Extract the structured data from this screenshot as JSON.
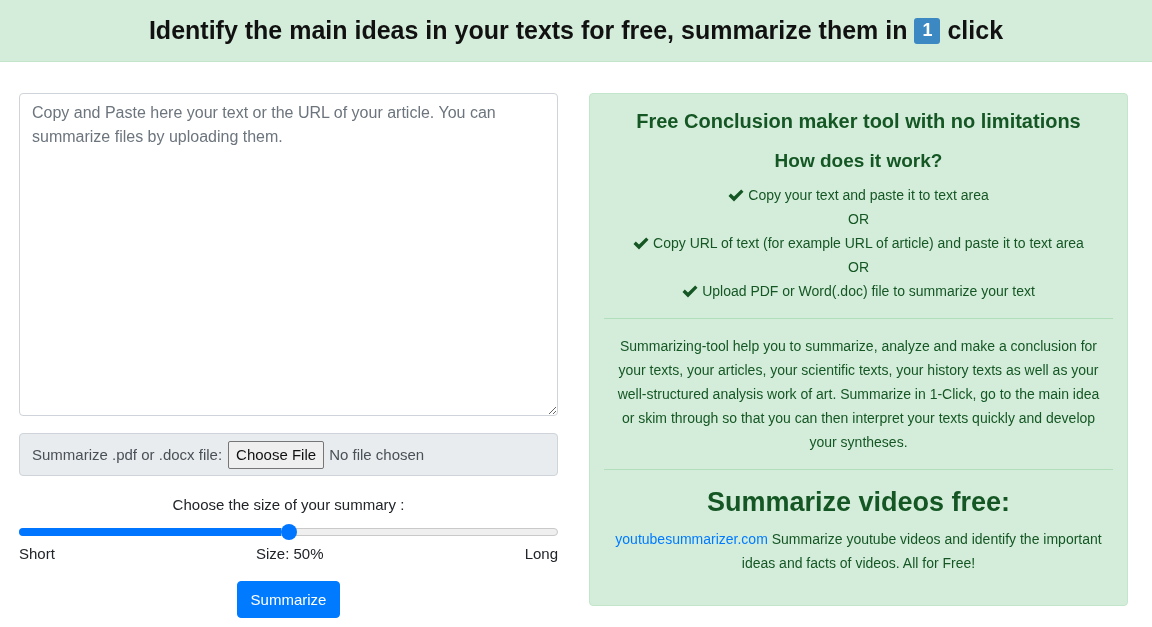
{
  "header": {
    "title": "Identify the main ideas in your texts for free, summarize them in",
    "keycap": "1",
    "title_end": "click"
  },
  "text_input": {
    "placeholder": "Copy and Paste here your text or the URL of your article. You can summarize files by uploading them."
  },
  "file_upload": {
    "label": "Summarize .pdf or .docx file:",
    "button": "Choose File",
    "status": "No file chosen"
  },
  "size_slider": {
    "label": "Choose the size of your summary :",
    "level": 0.5,
    "min_label": "Short",
    "reading": "Size: 50%",
    "max_label": "Long"
  },
  "submit_button": "Summarize",
  "info_panel": {
    "title": "Free Conclusion maker tool with no limitations",
    "subtitle": "How does it work?",
    "steps": [
      {
        "kind": "step",
        "text": "Copy your text and paste it to text area"
      },
      {
        "kind": "or",
        "text": "OR"
      },
      {
        "kind": "step",
        "text": "Copy URL of text (for example URL of article) and paste it to text area"
      },
      {
        "kind": "or",
        "text": "OR"
      },
      {
        "kind": "step",
        "text": "Upload PDF or Word(.doc) file to summarize your text"
      }
    ],
    "description": "Summarizing-tool help you to summarize, analyze and make a conclusion for your texts, your articles, your scientific texts, your history texts as well as your well-structured analysis work of art. Summarize in 1-Click, go to the main idea or skim through so that you can then interpret your texts quickly and develop your syntheses.",
    "videos_heading": "Summarize videos free:",
    "videos_link": "youtubesummarizer.com",
    "videos_text": "Summarize youtube videos and identify the important ideas and facts of videos. All for Free!"
  }
}
